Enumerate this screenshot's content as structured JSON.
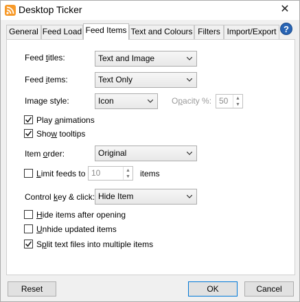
{
  "window": {
    "title": "Desktop Ticker",
    "icon": "rss-icon",
    "close_glyph": "✕"
  },
  "tabs": [
    {
      "label": "General",
      "active": false
    },
    {
      "label": "Feed Load",
      "active": false
    },
    {
      "label": "Feed Items",
      "active": true
    },
    {
      "label": "Text and Colours",
      "active": false
    },
    {
      "label": "Filters",
      "active": false
    },
    {
      "label": "Import/Export",
      "active": false
    }
  ],
  "help": {
    "glyph": "?",
    "icon": "help-icon"
  },
  "form": {
    "feed_titles": {
      "pre": "Feed ",
      "u": "t",
      "post": "itles:",
      "value": "Text and Image"
    },
    "feed_items": {
      "pre": "Feed ",
      "u": "i",
      "post": "tems:",
      "value": "Text Only"
    },
    "image_style": {
      "label": "Image style:",
      "value": "Icon"
    },
    "opacity": {
      "pre": "O",
      "u": "p",
      "post": "acity %:",
      "value": "50"
    },
    "play_animations": {
      "pre": "Play ",
      "u": "a",
      "post": "nimations",
      "checked": true
    },
    "show_tooltips": {
      "pre": "Sho",
      "u": "w",
      "post": " tooltips",
      "checked": true
    },
    "item_order": {
      "pre": "Item ",
      "u": "o",
      "post": "rder:",
      "value": "Original"
    },
    "limit_feeds": {
      "pre": "",
      "u": "L",
      "post": "imit feeds to",
      "value": "10",
      "suffix": "items",
      "checked": false
    },
    "control_key": {
      "pre": "Control ",
      "u": "k",
      "post": "ey & click:",
      "value": "Hide Item"
    },
    "hide_items": {
      "pre": "",
      "u": "H",
      "post": "ide items after opening",
      "checked": false
    },
    "unhide_items": {
      "pre": "",
      "u": "U",
      "post": "nhide updated items",
      "checked": false
    },
    "split_text": {
      "pre": "S",
      "u": "p",
      "post": "lit text files into multiple items",
      "checked": true
    }
  },
  "buttons": {
    "reset": "Reset",
    "ok": "OK",
    "cancel": "Cancel"
  }
}
